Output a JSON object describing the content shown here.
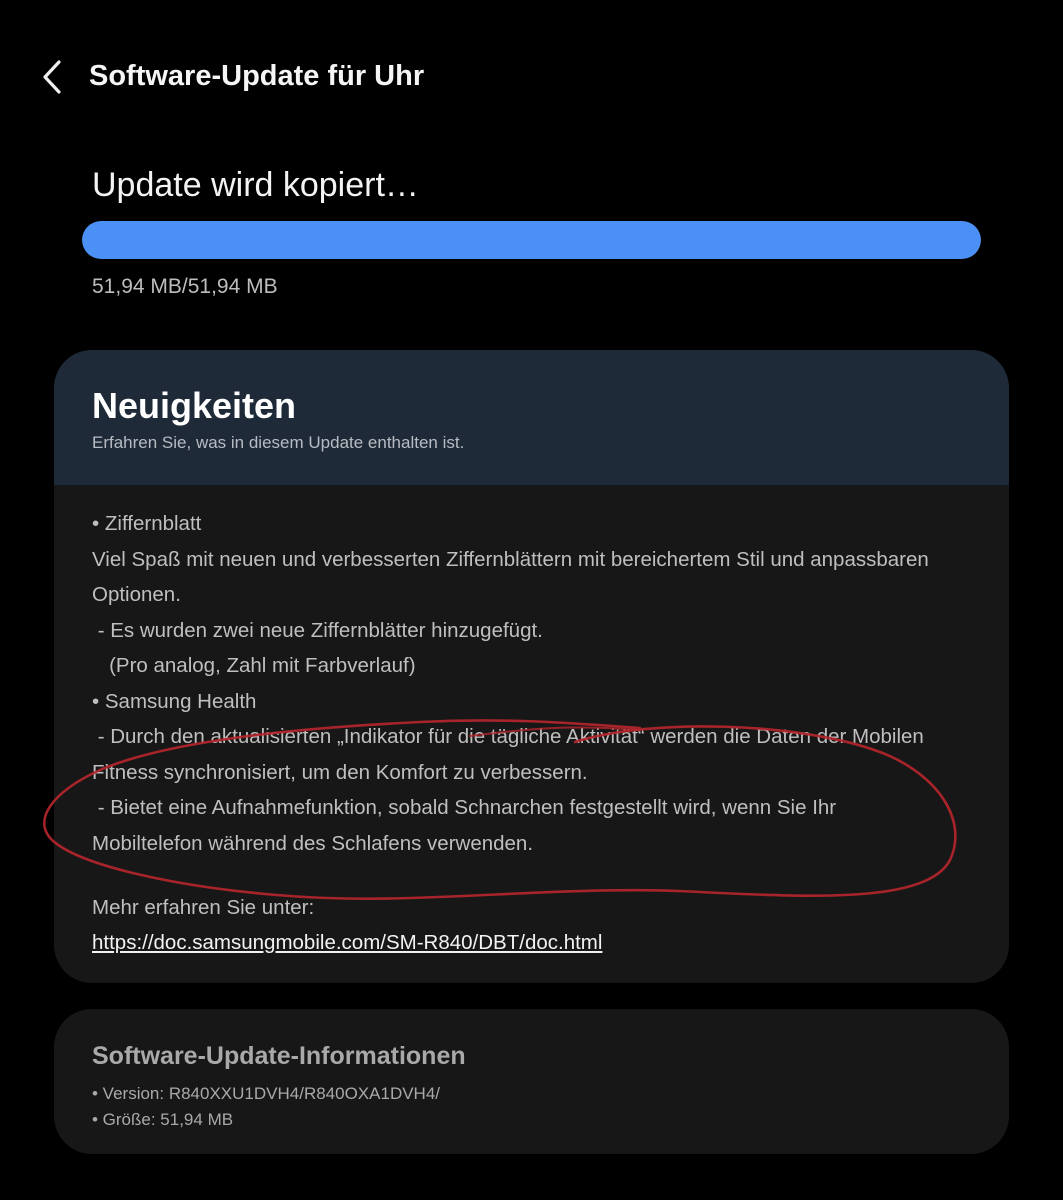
{
  "header": {
    "back_icon": "chevron-left-icon",
    "title": "Software-Update für Uhr"
  },
  "status": {
    "title": "Update wird kopiert…",
    "progress_fraction": 1.0,
    "progress_text": "51,94 MB/51,94 MB"
  },
  "news": {
    "title": "Neuigkeiten",
    "subtitle": "Erfahren Sie, was in diesem Update enthalten ist.",
    "lines": [
      "• Ziffernblatt",
      "Viel Spaß mit neuen und verbesserten Ziffernblättern mit bereichertem Stil und anpassbaren",
      "Optionen.",
      " - Es wurden zwei neue Ziffernblätter hinzugefügt.",
      "   (Pro analog, Zahl mit Farbverlauf)",
      "• Samsung Health",
      " - Durch den aktualisierten „Indikator für die tägliche Aktivität“ werden die Daten der Mobilen",
      "Fitness synchronisiert, um den Komfort zu verbessern.",
      " - Bietet eine Aufnahmefunktion, sobald Schnarchen festgestellt wird, wenn Sie Ihr",
      "Mobiltelefon während des Schlafens verwenden."
    ],
    "learn_more": "Mehr erfahren Sie unter:",
    "link": "https://doc.samsungmobile.com/SM-R840/DBT/doc.html"
  },
  "info": {
    "title": "Software-Update-Informationen",
    "version": "• Version: R840XXU1DVH4/R840OXA1DVH4/",
    "size": "• Größe: 51,94 MB"
  },
  "colors": {
    "progress": "#4b90f5",
    "annotation": "#b3262d",
    "news_header": "#1f2a38",
    "card": "#171717"
  }
}
